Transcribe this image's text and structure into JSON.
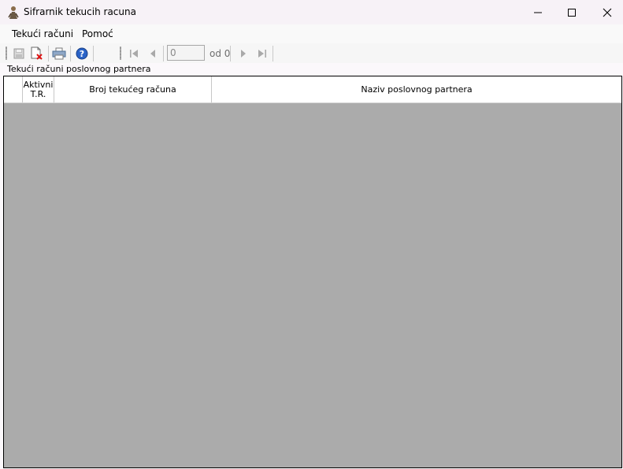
{
  "window": {
    "title": "Sifrarnik tekucih racuna"
  },
  "menu": {
    "items": [
      "Tekući računi",
      "Pomoć"
    ]
  },
  "navigator": {
    "position": "0",
    "count_label": "od 0"
  },
  "panel": {
    "label": "Tekući računi poslovnog partnera"
  },
  "grid": {
    "columns": [
      "Aktivni T.R.",
      "Broj tekućeg računa",
      "Naziv poslovnog partnera"
    ],
    "rows": []
  },
  "colors": {
    "grid_background": "#ababab",
    "titlebar": "#f7f2f7"
  },
  "icons": [
    "app-icon",
    "save-icon",
    "delete-icon",
    "print-icon",
    "help-icon",
    "move-first-icon",
    "move-previous-icon",
    "move-next-icon",
    "move-last-icon",
    "minimize-icon",
    "maximize-icon",
    "close-icon"
  ]
}
